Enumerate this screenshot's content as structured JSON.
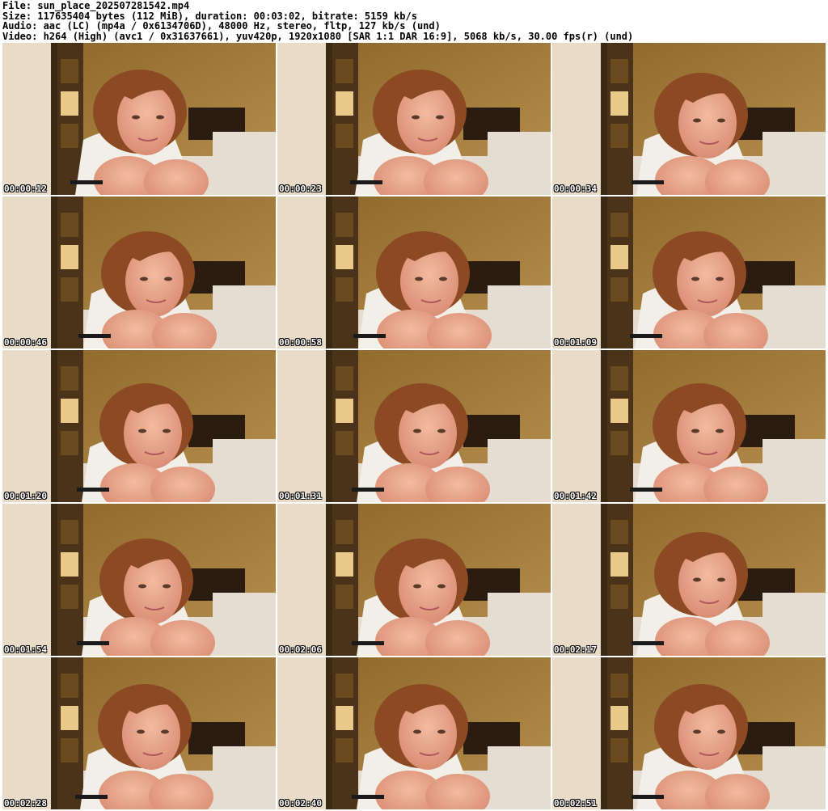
{
  "header": {
    "file": "File: sun_place_202507281542.mp4",
    "size": "Size: 117635404 bytes (112 MiB), duration: 00:03:02, bitrate: 5159 kb/s",
    "audio": "Audio: aac (LC) (mp4a / 0x6134706D), 48000 Hz, stereo, fltp, 127 kb/s (und)",
    "video": "Video: h264 (High) (avc1 / 0x31637661), yuv420p, 1920x1080 [SAR 1:1 DAR 16:9], 5068 kb/s, 30.00 fps(r) (und)"
  },
  "thumbnails": [
    {
      "timestamp": "00:00:12"
    },
    {
      "timestamp": "00:00:23"
    },
    {
      "timestamp": "00:00:34"
    },
    {
      "timestamp": "00:00:46"
    },
    {
      "timestamp": "00:00:58"
    },
    {
      "timestamp": "00:01:09"
    },
    {
      "timestamp": "00:01:20"
    },
    {
      "timestamp": "00:01:31"
    },
    {
      "timestamp": "00:01:42"
    },
    {
      "timestamp": "00:01:54"
    },
    {
      "timestamp": "00:02:06"
    },
    {
      "timestamp": "00:02:17"
    },
    {
      "timestamp": "00:02:28"
    },
    {
      "timestamp": "00:02:40"
    },
    {
      "timestamp": "00:02:51"
    }
  ],
  "colors": {
    "wall": "#c9a46a",
    "door": "#e8dcc8",
    "cabinet": "#4a3318",
    "hair": "#8b4a24",
    "skin": "#e8a88e",
    "shirt": "#f2efe9",
    "bedding": "#e6ddd2"
  }
}
